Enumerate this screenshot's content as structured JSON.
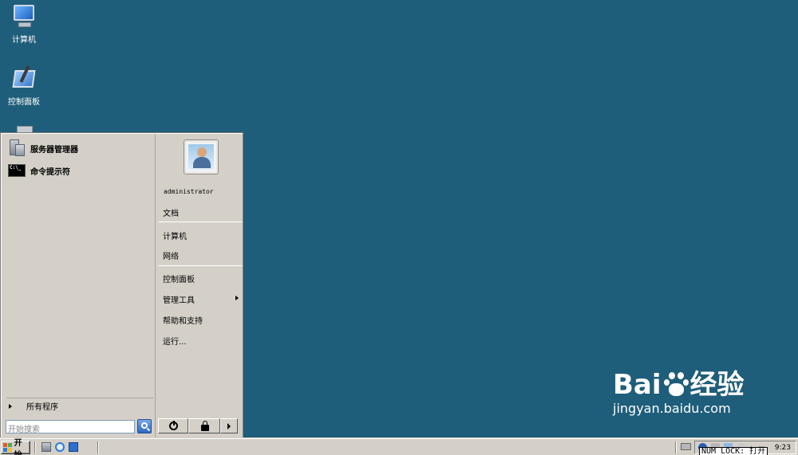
{
  "desktop": {
    "icons": [
      {
        "label": "计算机",
        "icon": "computer-icon"
      },
      {
        "label": "控制面板",
        "icon": "control-panel-icon"
      },
      {
        "label": "",
        "icon": "recycle-bin-icon"
      }
    ]
  },
  "start_menu": {
    "pinned": [
      {
        "label": "服务器管理器",
        "icon": "server-manager-icon"
      },
      {
        "label": "命令提示符",
        "icon": "command-prompt-icon"
      }
    ],
    "all_programs": "所有程序",
    "search_placeholder": "开始搜索",
    "user": "administrator",
    "right_items": {
      "documents": "文档",
      "computer": "计算机",
      "network": "网络",
      "control_panel": "控制面板",
      "admin_tools": "管理工具",
      "help_support": "帮助和支持",
      "run": "运行..."
    }
  },
  "taskbar": {
    "start_label": "开始",
    "clock": "9:23",
    "numlock": "NUM LOCK: 打开"
  },
  "watermark": {
    "brand_left": "Bai",
    "brand_right": "经验",
    "url": "jingyan.baidu.com"
  },
  "colors": {
    "desktop": "#1f5e7a",
    "menu_bg": "#d4d0c8"
  }
}
